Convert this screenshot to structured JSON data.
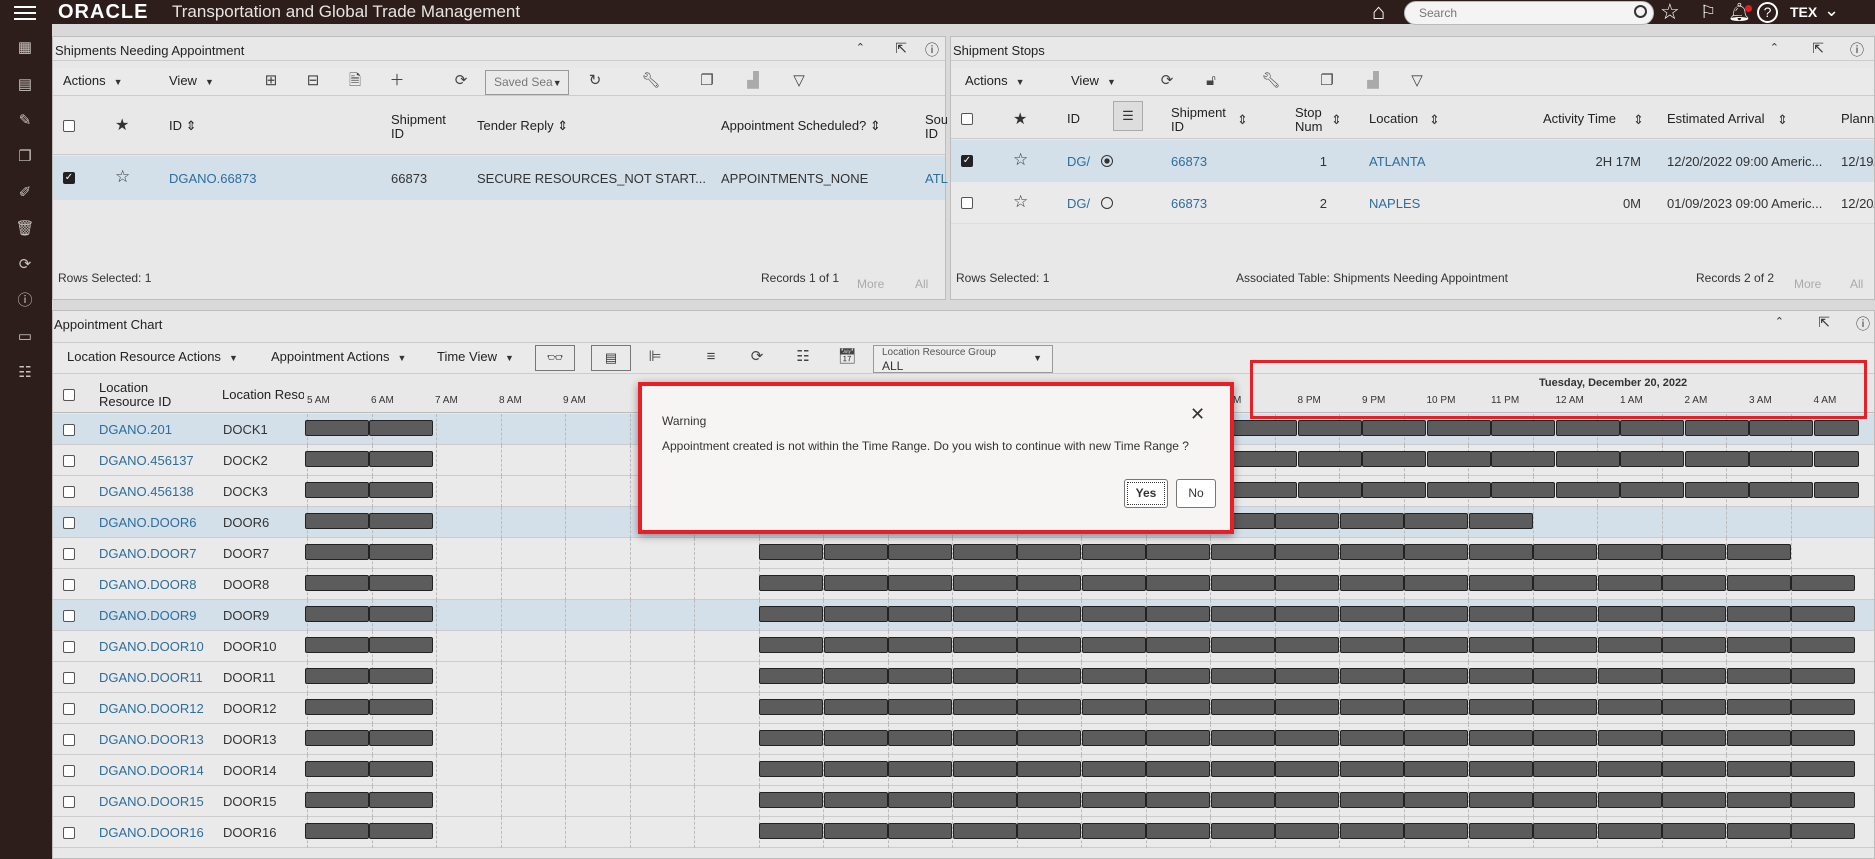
{
  "app": {
    "brand": "ORACLE",
    "title": "Transportation and Global Trade Management",
    "search_placeholder": "Search",
    "user": "TEX"
  },
  "shipments_panel": {
    "title": "Shipments Needing Appointment",
    "toolbar": {
      "actions": "Actions",
      "view": "View",
      "saved_search": "Saved Sea"
    },
    "columns": [
      "ID",
      "Shipment ID",
      "Tender Reply",
      "Appointment Scheduled?",
      "Sou ID"
    ],
    "rows": [
      {
        "id": "DGANO.66873",
        "shipment_id": "66873",
        "tender_reply": "SECURE RESOURCES_NOT START...",
        "appointment": "APPOINTMENTS_NONE",
        "source": "ATL"
      }
    ],
    "rows_selected": "Rows Selected: 1",
    "records": "Records 1 of 1",
    "more": "More",
    "all": "All"
  },
  "stops_panel": {
    "title": "Shipment Stops",
    "toolbar": {
      "actions": "Actions",
      "view": "View"
    },
    "columns": {
      "id": "ID",
      "shipment_id": "Shipment ID",
      "stop_num": "Stop Num",
      "location": "Location",
      "activity_time": "Activity Time",
      "est_arrival": "Estimated Arrival",
      "planned": "Planne"
    },
    "rows": [
      {
        "id": "DG/",
        "shipment_id": "66873",
        "stop_num": "1",
        "location": "ATLANTA",
        "activity_time": "2H 17M",
        "est_arrival": "12/20/2022 09:00 Americ...",
        "planned": "12/19/"
      },
      {
        "id": "DG/",
        "shipment_id": "66873",
        "stop_num": "2",
        "location": "NAPLES",
        "activity_time": "0M",
        "est_arrival": "01/09/2023 09:00 Americ...",
        "planned": "12/20/"
      }
    ],
    "rows_selected": "Rows Selected: 1",
    "associated": "Associated Table: Shipments Needing Appointment",
    "records": "Records 2 of 2",
    "more": "More",
    "all": "All"
  },
  "chart_panel": {
    "title": "Appointment Chart",
    "toolbar": {
      "lra": "Location Resource Actions",
      "aa": "Appointment Actions",
      "tv": "Time View",
      "group_label": "Location Resource Group",
      "group_value": "ALL"
    },
    "col_id": "Location Resource ID",
    "col_name": "Location Reso",
    "date_label": "Tuesday, December 20, 2022",
    "hours_left": [
      "5 AM",
      "6 AM",
      "7 AM",
      "8 AM",
      "9 AM"
    ],
    "hours_right": [
      "M",
      "8 PM",
      "9 PM",
      "10 PM",
      "11 PM",
      "12 AM",
      "1 AM",
      "2 AM",
      "3 AM",
      "4 AM"
    ],
    "rows": [
      {
        "id": "DGANO.201",
        "name": "DOCK1"
      },
      {
        "id": "DGANO.456137",
        "name": "DOCK2"
      },
      {
        "id": "DGANO.456138",
        "name": "DOCK3"
      },
      {
        "id": "DGANO.DOOR6",
        "name": "DOOR6"
      },
      {
        "id": "DGANO.DOOR7",
        "name": "DOOR7"
      },
      {
        "id": "DGANO.DOOR8",
        "name": "DOOR8"
      },
      {
        "id": "DGANO.DOOR9",
        "name": "DOOR9"
      },
      {
        "id": "DGANO.DOOR10",
        "name": "DOOR10"
      },
      {
        "id": "DGANO.DOOR11",
        "name": "DOOR11"
      },
      {
        "id": "DGANO.DOOR12",
        "name": "DOOR12"
      },
      {
        "id": "DGANO.DOOR13",
        "name": "DOOR13"
      },
      {
        "id": "DGANO.DOOR14",
        "name": "DOOR14"
      },
      {
        "id": "DGANO.DOOR15",
        "name": "DOOR15"
      },
      {
        "id": "DGANO.DOOR16",
        "name": "DOOR16"
      }
    ]
  },
  "dialog": {
    "title": "Warning",
    "message": "Appointment created is not within the Time Range. Do you wish to continue with new Time Range ?",
    "yes": "Yes",
    "no": "No"
  }
}
